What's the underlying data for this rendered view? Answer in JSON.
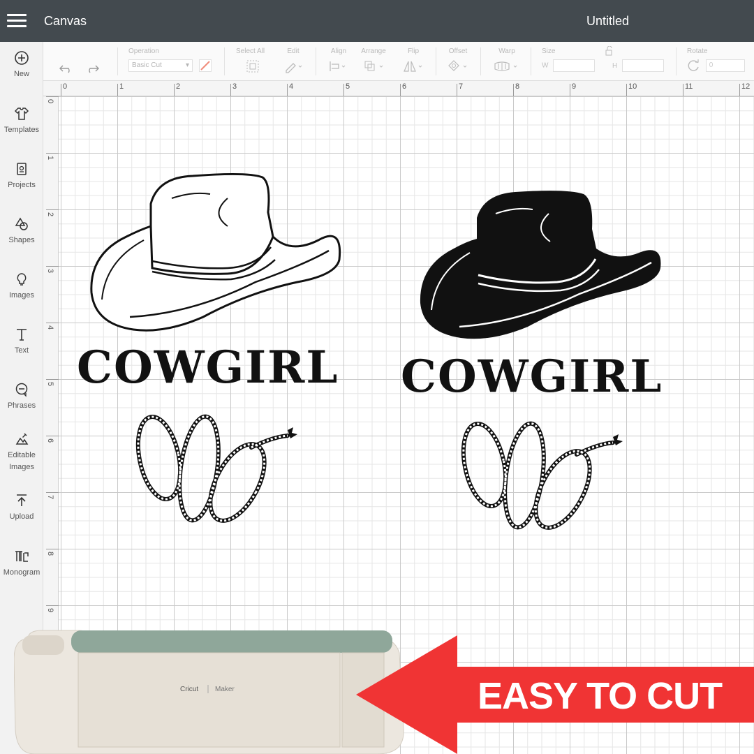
{
  "header": {
    "app_title": "Canvas",
    "document_title": "Untitled"
  },
  "sidebar": {
    "items": [
      {
        "label": "New",
        "icon": "plus-circle-icon"
      },
      {
        "label": "Templates",
        "icon": "shirt-icon"
      },
      {
        "label": "Projects",
        "icon": "projects-icon"
      },
      {
        "label": "Shapes",
        "icon": "shapes-icon"
      },
      {
        "label": "Images",
        "icon": "lightbulb-icon"
      },
      {
        "label": "Text",
        "icon": "text-icon"
      },
      {
        "label": "Phrases",
        "icon": "speech-bubble-icon"
      },
      {
        "label": "Editable Images",
        "icon": "editable-images-icon"
      },
      {
        "label": "Upload",
        "icon": "upload-icon"
      },
      {
        "label": "Monogram",
        "icon": "monogram-icon"
      }
    ]
  },
  "toolbar": {
    "operation_label": "Operation",
    "operation_value": "Basic Cut",
    "select_all_label": "Select All",
    "edit_label": "Edit",
    "align_label": "Align",
    "arrange_label": "Arrange",
    "flip_label": "Flip",
    "offset_label": "Offset",
    "warp_label": "Warp",
    "size_label": "Size",
    "size_w": "W",
    "size_h": "H",
    "rotate_label": "Rotate",
    "rotate_value": "0"
  },
  "ruler": {
    "top": [
      "0",
      "1",
      "2",
      "3",
      "4",
      "5",
      "6",
      "7",
      "8",
      "9",
      "10",
      "11",
      "12"
    ],
    "left": [
      "0",
      "1",
      "2",
      "3",
      "4",
      "5",
      "6",
      "7",
      "8",
      "9"
    ]
  },
  "designs": {
    "left_text": "COWGIRL",
    "right_text": "COWGIRL"
  },
  "machine": {
    "brand": "Cricut",
    "model": "Maker"
  },
  "banner": {
    "text": "EASY TO CUT",
    "color": "#f03434"
  }
}
